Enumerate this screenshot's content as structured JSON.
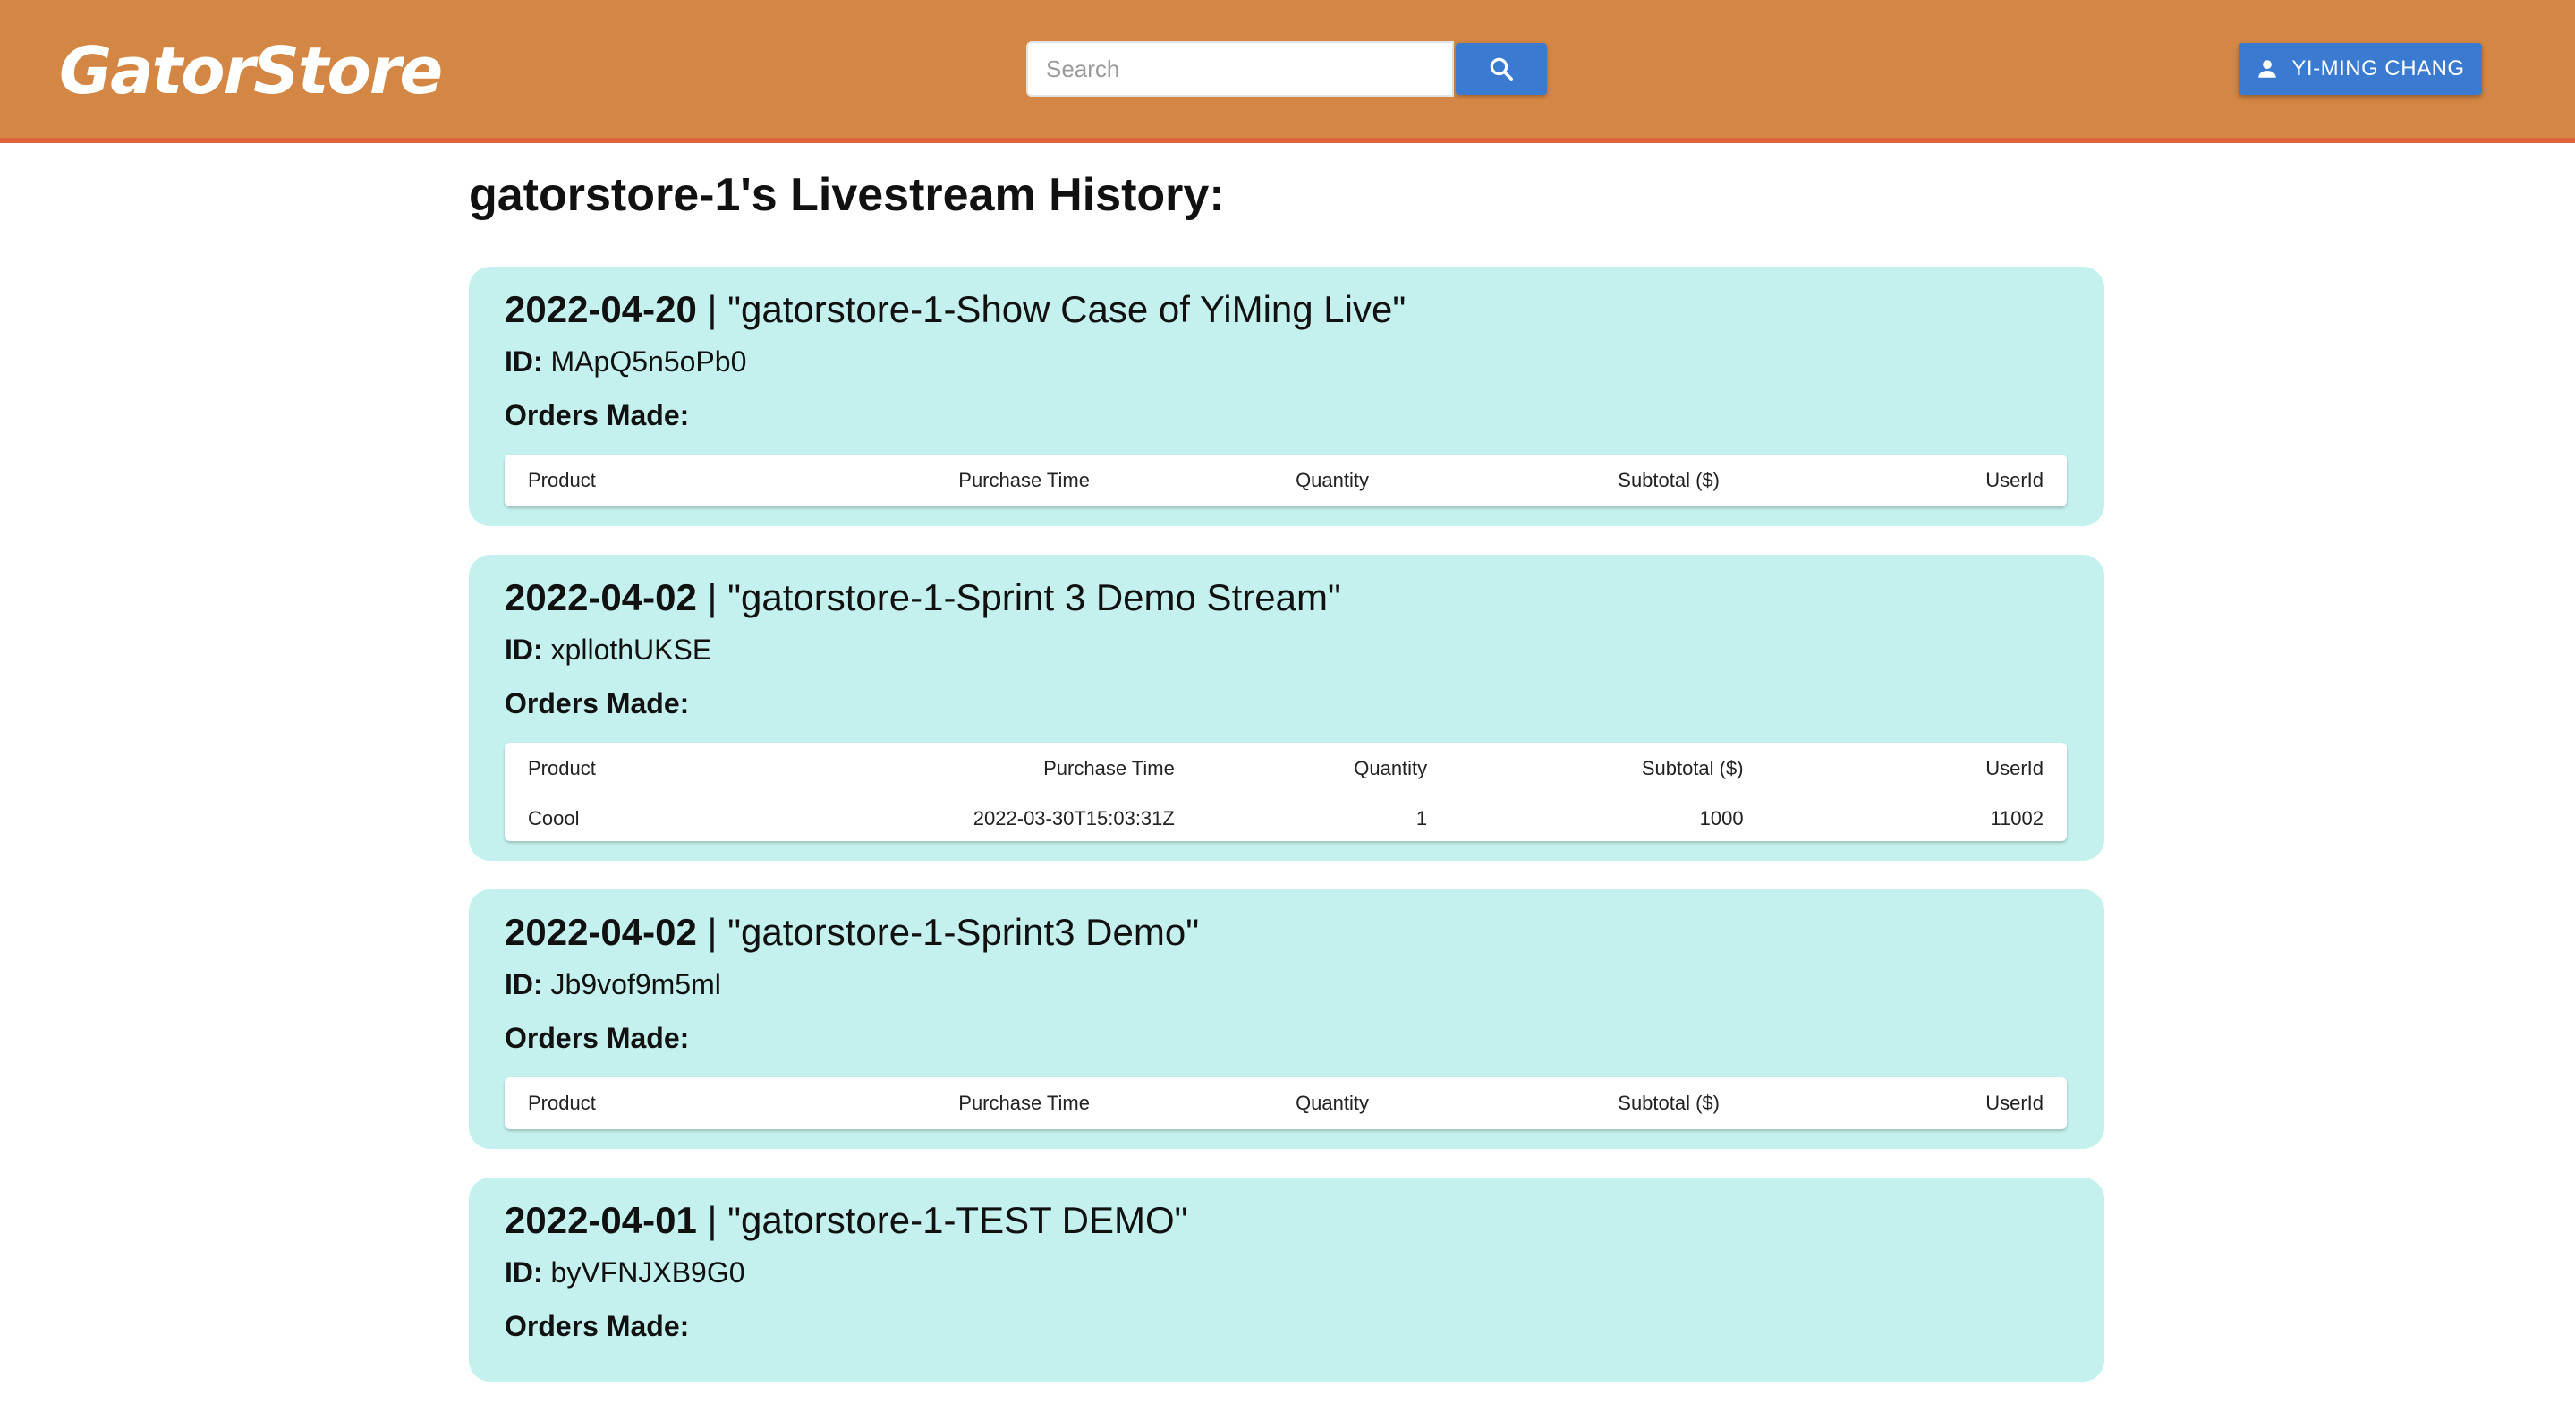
{
  "header": {
    "logo": "GatorStore",
    "search_placeholder": "Search",
    "user_name": "YI-MING CHANG",
    "colors": {
      "header_bg": "#d48744",
      "header_border": "#e0623a",
      "button_blue": "#3a7bd1",
      "card_bg": "#c4f1ee"
    }
  },
  "page": {
    "title": "gatorstore-1's Livestream History:",
    "id_label": "ID:",
    "orders_label": "Orders Made:",
    "separator": " | ",
    "columns": [
      "Product",
      "Purchase Time",
      "Quantity",
      "Subtotal ($)",
      "UserId"
    ]
  },
  "streams": [
    {
      "date": "2022-04-20",
      "title": "\"gatorstore-1-Show Case of YiMing Live\"",
      "id": "MApQ5n5oPb0",
      "orders": []
    },
    {
      "date": "2022-04-02",
      "title": "\"gatorstore-1-Sprint 3 Demo Stream\"",
      "id": "xpllothUKSE",
      "orders": [
        {
          "product": "Coool",
          "purchase_time": "2022-03-30T15:03:31Z",
          "quantity": "1",
          "subtotal": "1000",
          "user_id": "11002"
        }
      ]
    },
    {
      "date": "2022-04-02",
      "title": "\"gatorstore-1-Sprint3 Demo\"",
      "id": "Jb9vof9m5ml",
      "orders": []
    },
    {
      "date": "2022-04-01",
      "title": "\"gatorstore-1-TEST DEMO\"",
      "id": "byVFNJXB9G0",
      "orders": []
    }
  ]
}
